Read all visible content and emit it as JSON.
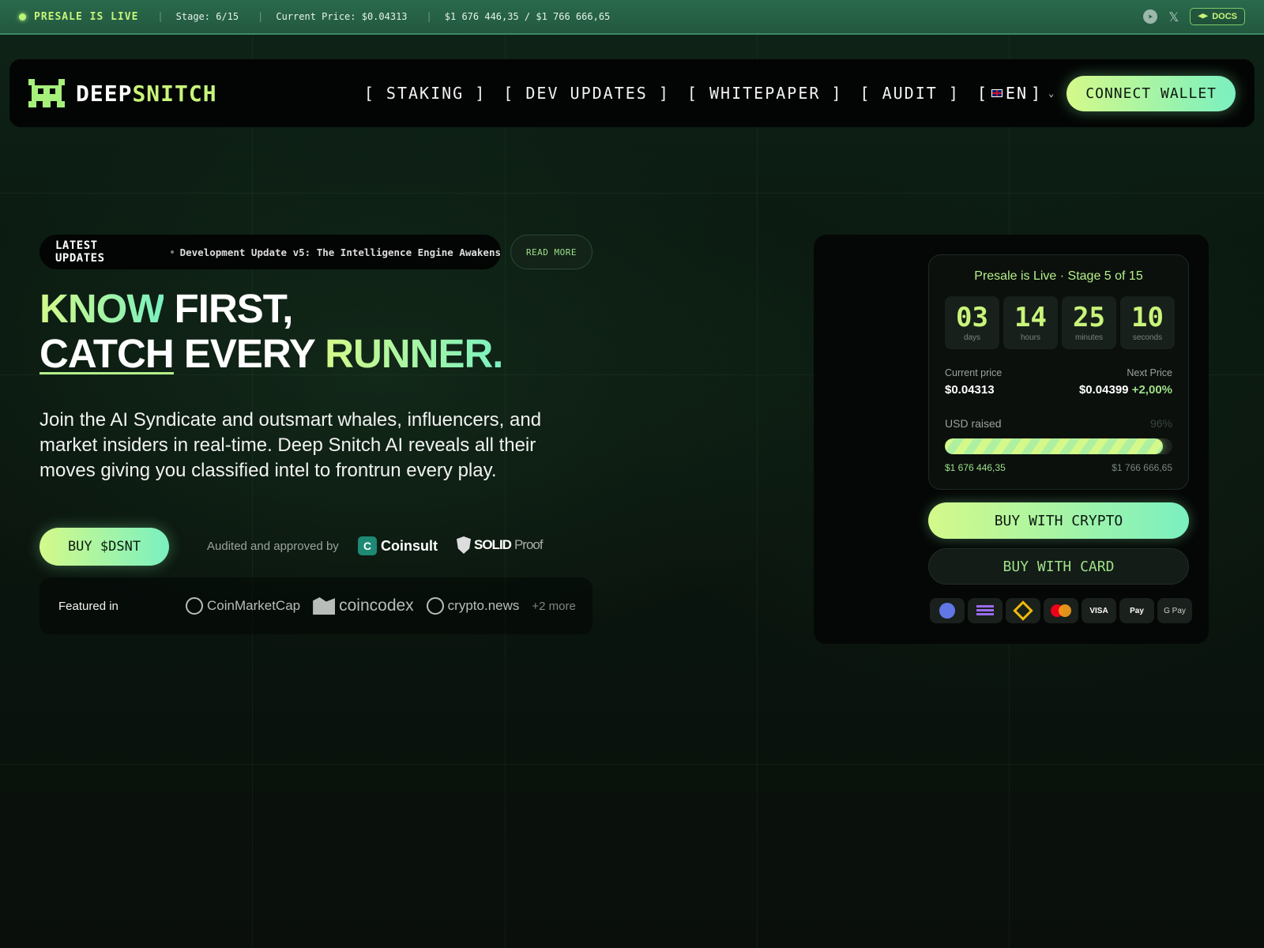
{
  "ticker": {
    "live": "PRESALE IS LIVE",
    "stage": "Stage: 6/15",
    "price": "Current Price: $0.04313",
    "raised": "$1 676 446,35 / $1 766 666,65",
    "docs": "DOCS"
  },
  "nav": {
    "logo_a": "DEEP",
    "logo_b": "SNITCH",
    "links": [
      "[ STAKING ]",
      "[ DEV UPDATES ]",
      "[ WHITEPAPER ]",
      "[ AUDIT ]"
    ],
    "lang_open": "[",
    "lang": "EN",
    "lang_close": "]",
    "connect": "CONNECT WALLET"
  },
  "updates": {
    "label": "LATEST UPDATES",
    "message": "Development Update v5: The Intelligence Engine Awakens",
    "read_more": "READ MORE"
  },
  "hero": {
    "line1_a": "KNOW",
    "line1_b": " FIRST,",
    "line2_a": "CATCH",
    "line2_b": " EVERY ",
    "line2_c": "RUNNER.",
    "subtext": "Join the AI Syndicate and outsmart whales, influencers, and market insiders in real-time. Deep Snitch AI reveals all their moves giving you classified intel to frontrun every play.",
    "buy": "BUY $DSNT",
    "audited": "Audited and approved by",
    "auditor1": "Coinsult",
    "auditor2_a": "SOLID",
    "auditor2_b": "Proof"
  },
  "featured": {
    "label": "Featured in",
    "logos": [
      "CoinMarketCap",
      "coincodex",
      "crypto.news"
    ],
    "more": "+2 more"
  },
  "presale": {
    "title": "Presale is Live · Stage 5 of 15",
    "countdown": [
      {
        "value": "03",
        "label": "days"
      },
      {
        "value": "14",
        "label": "hours"
      },
      {
        "value": "25",
        "label": "minutes"
      },
      {
        "value": "10",
        "label": "seconds"
      }
    ],
    "current_price_label": "Current price",
    "current_price": "$0.04313",
    "next_price_label": "Next Price",
    "next_price": "$0.04399",
    "next_change": "+2,00%",
    "raised_label": "USD raised",
    "raised_pct": "96%",
    "progress": 0.96,
    "raised_amount": "$1 676 446,35",
    "target_amount": "$1 766 666,65",
    "buy_crypto": "BUY WITH CRYPTO",
    "buy_card": "BUY WITH CARD",
    "payments": {
      "visa": "VISA",
      "applepay": "Pay",
      "gpay": "G Pay"
    }
  },
  "icons": {
    "telegram": "telegram-icon",
    "x": "x-icon",
    "docs": "graduation-cap-icon"
  }
}
